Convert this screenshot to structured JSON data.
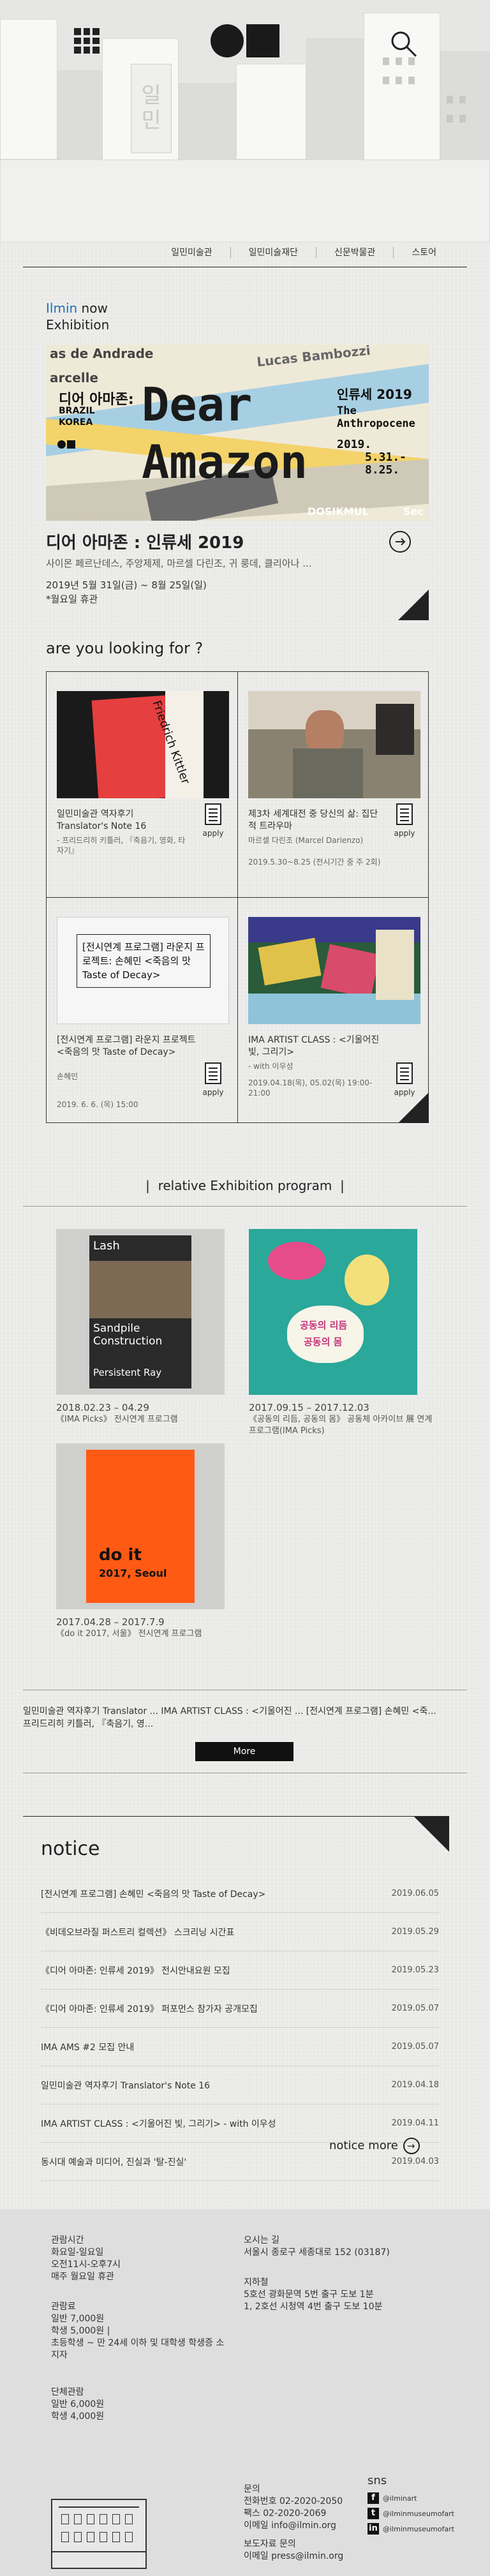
{
  "header": {
    "menu_icon": "grid-menu-icon",
    "logo_icon": "circle-square-logo",
    "search_icon": "search-icon",
    "hero_sign": [
      "일",
      "민"
    ]
  },
  "nav": {
    "items": [
      "일민미술관",
      "일민미술재단",
      "신문박물관",
      "스토어"
    ]
  },
  "now_exhibition": {
    "label_blue": "Ilmin",
    "label_rest": "now",
    "label_line2": "Exhibition",
    "banner": {
      "title_ko": "디어 아마존:",
      "sub1": "BRAZIL",
      "sub2": "KOREA",
      "title_en_1": "Dear",
      "title_en_2": "Amazon",
      "right_ko": "인류세 2019",
      "right_en_1": "The",
      "right_en_2": "Anthropocene",
      "right_date_1": "2019.",
      "right_date_2": "5.31.-",
      "right_date_3": "8.25.",
      "bg_words": [
        "as de Andrade",
        "Lucas Bambozzi",
        "arcelle",
        "DOSIKMUL",
        "Sec"
      ]
    },
    "title": "디어 아마존 : 인류세 2019",
    "desc": "사이몬 페르난데스, 주앙제제, 마르셀 다린조, 귀 룽데, 클리아나 ...",
    "date": "2019년 5월 31일(금) ~ 8월 25일(일)",
    "closed": "*월요일 휴관"
  },
  "looking": {
    "heading": "are you looking for ?",
    "cards": [
      {
        "title": "일민미술관 역자후기",
        "subtitle": "Translator's Note 16",
        "desc": "- 프리드리히 키틀러, 『축음기, 영화, 타자기』",
        "meta": "",
        "apply": "apply"
      },
      {
        "title": "제3차 세계대전 중 당신의 삶: 집단적 트라우마",
        "subtitle": "",
        "desc": "마르셀 다린조 (Marcel Darienzo)",
        "meta": "2019.5.30~8.25 (전시기간 중 주 2회)",
        "apply": "apply"
      },
      {
        "title": "[전시연계 프로그램] 라운지 프로젝트 <죽음의 맛 Taste of Decay>",
        "subtitle": "",
        "desc": "손혜민",
        "meta": "2019. 6. 6. (목) 15:00",
        "apply": "apply",
        "thumb_text": "[전시연계 프로그램] 라운지 프로젝트: 손혜민 <죽음의 맛 Taste of Decay>"
      },
      {
        "title": "IMA ARTIST CLASS : <기울어진 빛, 그리기>",
        "subtitle": "",
        "desc": "- with 이우성",
        "meta": "2019.04.18(목), 05.02(목) 19:00-21:00",
        "apply": "apply"
      }
    ]
  },
  "related": {
    "heading": "relative Exhibition program",
    "items": [
      {
        "date": "2018.02.23 – 04.29",
        "caption": "《IMA Picks》 전시연계 프로그램",
        "poster_lines": [
          "Lash",
          "Sandpile",
          "Construction",
          "Persistent Ray"
        ]
      },
      {
        "date": "2017.09.15 – 2017.12.03",
        "caption": "《공동의 리듬, 공동의 몸》 공동체 아카이브 展 연계 프로그램(IMA Picks)",
        "poster_lines": [
          "공동의 리듬",
          "공동의 몸"
        ]
      },
      {
        "date": "2017.04.28 – 2017.7.9",
        "caption": "《do it 2017, 서울》 전시연계 프로그램",
        "poster_lines": [
          "do it",
          "2017, Seoul"
        ]
      }
    ]
  },
  "ticker": {
    "text": "일민미술관 역자후기 Translator ... IMA ARTIST CLASS : <기울어진 ... [전시연계 프로그램] 손혜민 <죽...",
    "text2": "프리드리히 키틀러, 『축음기, 영...",
    "more_label": "More"
  },
  "notice": {
    "heading": "notice",
    "rows": [
      {
        "title": "[전시연계 프로그램] 손혜민 <죽음의 맛 Taste of Decay>",
        "date": "2019.06.05"
      },
      {
        "title": "《비데오브라질 퍼스트리 컬렉션》 스크리닝 시간표",
        "date": "2019.05.29"
      },
      {
        "title": "《디어 아마존: 인류세 2019》 전시안내요원 모집",
        "date": "2019.05.23"
      },
      {
        "title": "《디어 아마존: 인류세 2019》 퍼포먼스 참가자 공개모집",
        "date": "2019.05.07"
      },
      {
        "title": "IMA AMS #2 모집 안내",
        "date": "2019.05.07"
      },
      {
        "title": "일민미술관 역자후기 Translator's Note 16",
        "date": "2019.04.18"
      },
      {
        "title": "IMA ARTIST CLASS : <기울어진 빛, 그리기> - with 이우성",
        "date": "2019.04.11"
      },
      {
        "title": "동시대 예술과 미디어, 진실과 '탈-진실'",
        "date": "2019.04.03"
      }
    ],
    "more_label": "notice more"
  },
  "footer": {
    "hours": [
      "관람시간",
      "화요일-일요일",
      "오전11시-오후7시",
      "매주 월요일 휴관"
    ],
    "fees": [
      "관람료",
      "일반 7,000원",
      "학생 5,000원 |",
      "초등학생 ~ 만 24세 이하 및 대학생 학생증 소",
      "지자"
    ],
    "group": [
      "단체관람",
      "일반 6,000원",
      "학생 4,000원"
    ],
    "address": [
      "오시는 길",
      "서울시 종로구 세종대로 152 (03187)"
    ],
    "subway": [
      "지하철",
      "5호선 광화문역 5번 출구 도보 1분",
      "1, 2호선 시청역 4번 출구 도보 10분"
    ],
    "contact": [
      "문의",
      "전화번호 02-2020-2050",
      "팩스 02-2020-2069",
      "이메일 info@ilmin.org"
    ],
    "press": [
      "보도자료 문의",
      "이메일 press@ilmin.org"
    ],
    "sns_heading": "sns",
    "sns": [
      {
        "icon": "facebook-icon",
        "glyph": "f",
        "handle": "@ilminart"
      },
      {
        "icon": "twitter-icon",
        "glyph": "t",
        "handle": "@ilminmuseumofart"
      },
      {
        "icon": "linkedin-icon",
        "glyph": "in",
        "handle": "@ilminmuseumofart"
      }
    ]
  },
  "colors": {
    "accent_blue": "#1f6fb5",
    "ink": "#222222",
    "bg": "#ededeb"
  }
}
